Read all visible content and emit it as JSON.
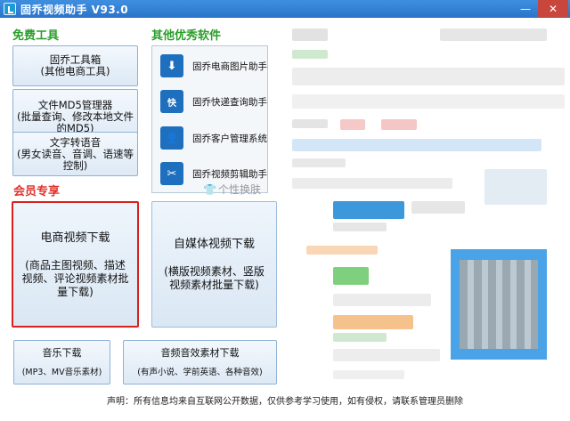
{
  "window": {
    "title": "固乔视频助手 V93.0",
    "minimize_glyph": "—",
    "close_glyph": "✕"
  },
  "free_tools": {
    "title": "免费工具",
    "buttons": [
      {
        "lines": [
          "固乔工具箱",
          "(其他电商工具)"
        ]
      },
      {
        "lines": [
          "文件MD5管理器",
          "(批量查询、修改本地文件",
          "的MD5)"
        ]
      },
      {
        "lines": [
          "文字转语音",
          "(男女读音、音调、语速等",
          "控制)"
        ]
      }
    ]
  },
  "other_software": {
    "title": "其他优秀软件",
    "items": [
      {
        "label": "固乔电商图片助手",
        "icon": "download-icon",
        "glyph": "⬇"
      },
      {
        "label": "固乔快递查询助手",
        "icon": "express-icon",
        "glyph": "快"
      },
      {
        "label": "固乔客户管理系统",
        "icon": "customer-icon",
        "glyph": "👤"
      },
      {
        "label": "固乔视频剪辑助手",
        "icon": "scissors-icon",
        "glyph": "✂"
      }
    ]
  },
  "vip": {
    "title": "会员专享",
    "skin_label": "个性换肤",
    "skin_icon": "tshirt-icon",
    "ecom_video": {
      "title": "电商视频下载",
      "desc": [
        "(商品主图视频、描述",
        "视频、评论视频素材批",
        "量下载)"
      ]
    },
    "media_video": {
      "title": "自媒体视频下载",
      "desc": [
        "(横版视频素材、竖版",
        "视频素材批量下载)"
      ]
    }
  },
  "bottom": {
    "music": {
      "title": "音乐下载",
      "desc": "(MP3、MV音乐素材)"
    },
    "audio": {
      "title": "音频音效素材下载",
      "desc": "(有声小说、学前英语、各种音效)"
    }
  },
  "footer": {
    "text": "声明：所有信息均来自互联网公开数据，仅供参考学习使用，如有侵权，请联系管理员删除"
  },
  "colors": {
    "titlebar": "#2a74c9",
    "section_green": "#2a9d2a",
    "section_red": "#e0332e",
    "highlight_border": "#d9211c",
    "icon_blue": "#1f6fbf"
  }
}
